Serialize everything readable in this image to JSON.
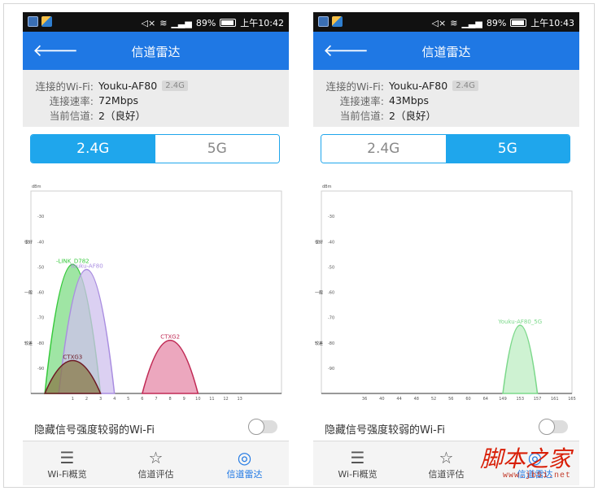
{
  "screens": [
    {
      "status": {
        "battery": "89%",
        "time": "上午10:42"
      },
      "title": "信道雷达",
      "info": {
        "wifi_label": "连接的Wi-Fi:",
        "wifi_value": "Youku-AF80",
        "band": "2.4G",
        "speed_label": "连接速率:",
        "speed_value": "72Mbps",
        "channel_label": "当前信道:",
        "channel_value": "2（良好）"
      },
      "tabs": [
        {
          "label": "2.4G",
          "active": true
        },
        {
          "label": "5G",
          "active": false
        }
      ],
      "chart_data": {
        "type": "area",
        "ylabel": "dBm",
        "yticks": [
          -30,
          -40,
          -50,
          -60,
          -70,
          -80,
          -90
        ],
        "ylim": [
          -100,
          -20
        ],
        "quality_labels": [
          {
            "label": "很好",
            "at": -40
          },
          {
            "label": "一般",
            "at": -60
          },
          {
            "label": "较差",
            "at": -80
          }
        ],
        "xticks": [
          "1",
          "2",
          "3",
          "4",
          "5",
          "6",
          "7",
          "8",
          "9",
          "10",
          "11",
          "12",
          "13"
        ],
        "xlim": [
          -2,
          16
        ],
        "series": [
          {
            "name": "-LINK_D782",
            "center": 1,
            "width": 4,
            "peak": -49,
            "color": "#35c93a",
            "fill": "#7fdc85"
          },
          {
            "name": "Youku-AF80",
            "center": 2,
            "width": 4,
            "peak": -51,
            "color": "#a98de0",
            "fill": "#cfc0ee"
          },
          {
            "name": "CTXG3",
            "center": 1,
            "width": 4,
            "peak": -87,
            "color": "#6e1a24",
            "fill": "#8a7a48"
          },
          {
            "name": "CTXG2",
            "center": 8,
            "width": 4,
            "peak": -79,
            "color": "#c02a55",
            "fill": "#e58aa8"
          }
        ]
      },
      "toggle_label": "隐藏信号强度较弱的Wi-Fi",
      "nav": [
        {
          "label": "Wi-Fi概览",
          "icon": "wifi-overview-icon",
          "active": false
        },
        {
          "label": "信道评估",
          "icon": "star-icon",
          "active": false
        },
        {
          "label": "信道雷达",
          "icon": "radar-icon",
          "active": true
        }
      ]
    },
    {
      "status": {
        "battery": "89%",
        "time": "上午10:43"
      },
      "title": "信道雷达",
      "info": {
        "wifi_label": "连接的Wi-Fi:",
        "wifi_value": "Youku-AF80",
        "band": "2.4G",
        "speed_label": "连接速率:",
        "speed_value": "43Mbps",
        "channel_label": "当前信道:",
        "channel_value": "2（良好）"
      },
      "tabs": [
        {
          "label": "2.4G",
          "active": false
        },
        {
          "label": "5G",
          "active": true
        }
      ],
      "chart_data": {
        "type": "area",
        "ylabel": "dBm",
        "yticks": [
          -30,
          -40,
          -50,
          -60,
          -70,
          -80,
          -90
        ],
        "ylim": [
          -100,
          -20
        ],
        "quality_labels": [
          {
            "label": "很好",
            "at": -40
          },
          {
            "label": "一般",
            "at": -60
          },
          {
            "label": "较差",
            "at": -80
          }
        ],
        "xticks": [
          "36",
          "40",
          "44",
          "48",
          "52",
          "56",
          "60",
          "64",
          "149",
          "153",
          "157",
          "161",
          "165"
        ],
        "xlim": [
          -1.5,
          13
        ],
        "series": [
          {
            "name": "Youku-AF80_5G",
            "center": 10,
            "width": 2,
            "peak": -73,
            "color": "#7bd88a",
            "fill": "#bdeec3"
          }
        ]
      },
      "toggle_label": "隐藏信号强度较弱的Wi-Fi",
      "nav": [
        {
          "label": "Wi-Fi概览",
          "icon": "wifi-overview-icon",
          "active": false
        },
        {
          "label": "信道评估",
          "icon": "star-icon",
          "active": false
        },
        {
          "label": "信道雷达",
          "icon": "radar-icon",
          "active": true
        }
      ]
    }
  ],
  "watermark": {
    "main": "脚本之家",
    "sub": "www.jb51.net"
  }
}
